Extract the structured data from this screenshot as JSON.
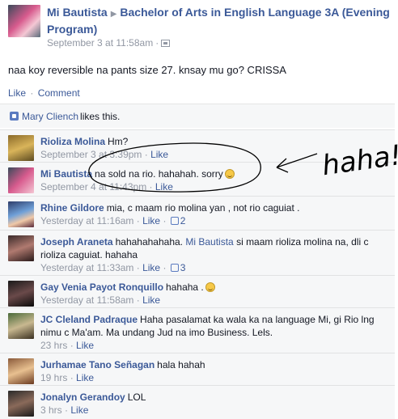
{
  "post": {
    "author": "Mi Bautista",
    "group": "Bachelor of Arts in English Language 3A (Evening Program)",
    "timestamp": "September 3 at 11:58am",
    "text": "naa koy reversible na pants size 27. knsay mu go? CRISSA",
    "actions": {
      "like": "Like",
      "comment": "Comment"
    }
  },
  "likes": {
    "name": "Mary Cliench",
    "suffix": "likes this."
  },
  "comments": [
    {
      "author": "Rioliza Molina",
      "text": "Hm?",
      "time": "September 3 at 3:39pm",
      "like": "Like"
    },
    {
      "author": "Mi Bautista",
      "text": "na sold na rio. hahahah. sorry",
      "time": "September 4 at 11:43pm",
      "like": "Like"
    },
    {
      "author": "Rhine Gildore",
      "text": "mia, c maam rio molina yan , not rio caguiat .",
      "time": "Yesterday at 11:16am",
      "like": "Like",
      "likes": "2"
    },
    {
      "author": "Joseph Araneta",
      "text_before": "hahahahahaha.",
      "mention": "Mi Bautista",
      "text_after": "si maam rioliza molina na, dli c rioliza caguiat. hahaha",
      "time": "Yesterday at 11:33am",
      "like": "Like",
      "likes": "3"
    },
    {
      "author": "Gay Venia Payot Ronquillo",
      "text": "hahaha .",
      "time": "Yesterday at 11:58am",
      "like": "Like"
    },
    {
      "author": "JC Cleland Padraque",
      "text": "Haha pasalamat ka wala ka na language Mi, gi Rio lng nimu c Ma'am. Ma undang Jud na imo Business. Lels.",
      "time": "23 hrs",
      "like": "Like"
    },
    {
      "author": "Jurhamae Tano Señagan",
      "text": "hala hahah",
      "time": "19 hrs",
      "like": "Like"
    },
    {
      "author": "Jonalyn Gerandoy",
      "text": "LOL",
      "time": "3 hrs",
      "like": "Like"
    }
  ],
  "doodle": {
    "text": "haha!"
  }
}
